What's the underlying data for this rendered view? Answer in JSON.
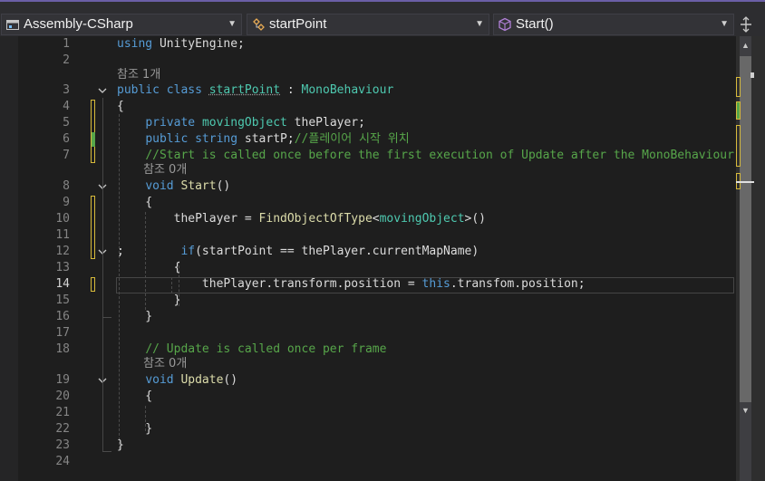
{
  "nav": {
    "project": "Assembly-CSharp",
    "type": "startPoint",
    "member": "Start()"
  },
  "editor": {
    "active_line": "14",
    "line_numbers": [
      "1",
      "2",
      "3",
      "4",
      "5",
      "6",
      "7",
      "8",
      "9",
      "10",
      "11",
      "12",
      "13",
      "14",
      "15",
      "16",
      "17",
      "18",
      "19",
      "20",
      "21",
      "22",
      "23",
      "24"
    ],
    "code_lens": {
      "class_refs": "참조 1개",
      "start_refs": "참조 0개",
      "update_refs": "참조 0개"
    },
    "lines": {
      "l1": [
        {
          "t": "using",
          "c": "kw"
        },
        {
          "t": " UnityEngine;",
          "c": "id"
        }
      ],
      "l3": [
        {
          "t": "public",
          "c": "kw"
        },
        {
          "t": " ",
          "c": "id"
        },
        {
          "t": "class",
          "c": "kw"
        },
        {
          "t": " ",
          "c": "id"
        },
        {
          "t": "startPoint",
          "c": "ty squig"
        },
        {
          "t": " : ",
          "c": "id"
        },
        {
          "t": "MonoBehaviour",
          "c": "ty"
        }
      ],
      "l4": [
        {
          "t": "{",
          "c": "id"
        }
      ],
      "l5": [
        {
          "t": "    ",
          "c": "id"
        },
        {
          "t": "private",
          "c": "kw"
        },
        {
          "t": " ",
          "c": "id"
        },
        {
          "t": "movingObject",
          "c": "ty"
        },
        {
          "t": " thePlayer;",
          "c": "id"
        }
      ],
      "l6": [
        {
          "t": "    ",
          "c": "id"
        },
        {
          "t": "public",
          "c": "kw"
        },
        {
          "t": " ",
          "c": "id"
        },
        {
          "t": "string",
          "c": "kw"
        },
        {
          "t": " startP;",
          "c": "id"
        },
        {
          "t": "//플레이어 시작 위치",
          "c": "cm"
        }
      ],
      "l7": [
        {
          "t": "    ",
          "c": "id"
        },
        {
          "t": "//Start is called once before the first execution of Update after the MonoBehaviour is cr",
          "c": "cm"
        }
      ],
      "l8": [
        {
          "t": "    ",
          "c": "id"
        },
        {
          "t": "void",
          "c": "kw"
        },
        {
          "t": " ",
          "c": "id"
        },
        {
          "t": "Start",
          "c": "fn"
        },
        {
          "t": "()",
          "c": "id"
        }
      ],
      "l9": [
        {
          "t": "    {",
          "c": "id"
        }
      ],
      "l10": [
        {
          "t": "        thePlayer = ",
          "c": "id"
        },
        {
          "t": "FindObjectOfType",
          "c": "fn"
        },
        {
          "t": "<",
          "c": "id"
        },
        {
          "t": "movingObject",
          "c": "ty"
        },
        {
          "t": ">()",
          "c": "id"
        }
      ],
      "l12": [
        {
          "t": ";        ",
          "c": "id"
        },
        {
          "t": "if",
          "c": "kw"
        },
        {
          "t": "(startPoint == thePlayer.currentMapName)",
          "c": "id"
        }
      ],
      "l13": [
        {
          "t": "        {",
          "c": "id"
        }
      ],
      "l14": [
        {
          "t": "            thePlayer.transform.position = ",
          "c": "id"
        },
        {
          "t": "this",
          "c": "kw"
        },
        {
          "t": ".transfom.position;",
          "c": "id"
        }
      ],
      "l15": [
        {
          "t": "        }",
          "c": "id"
        }
      ],
      "l16": [
        {
          "t": "    }",
          "c": "id"
        }
      ],
      "l18": [
        {
          "t": "    ",
          "c": "id"
        },
        {
          "t": "// Update is called once per frame",
          "c": "cm"
        }
      ],
      "l19": [
        {
          "t": "    ",
          "c": "id"
        },
        {
          "t": "void",
          "c": "kw"
        },
        {
          "t": " ",
          "c": "id"
        },
        {
          "t": "Update",
          "c": "fn"
        },
        {
          "t": "()",
          "c": "id"
        }
      ],
      "l20": [
        {
          "t": "    {",
          "c": "id"
        }
      ],
      "l22": [
        {
          "t": "    }",
          "c": "id"
        }
      ],
      "l23": [
        {
          "t": "}",
          "c": "id"
        }
      ]
    }
  },
  "colors": {
    "background": "#1e1e1e",
    "keyword": "#569cd6",
    "type": "#4ec9b0",
    "method": "#dcdcaa",
    "comment": "#57a64a",
    "change_saved": "#57a64a",
    "change_unsaved": "#d7ba3a",
    "accent": "#6b5fa7"
  },
  "icons": [
    "project-icon",
    "class-icon",
    "method-icon",
    "split-editor-icon",
    "fold-chevron-icon"
  ]
}
